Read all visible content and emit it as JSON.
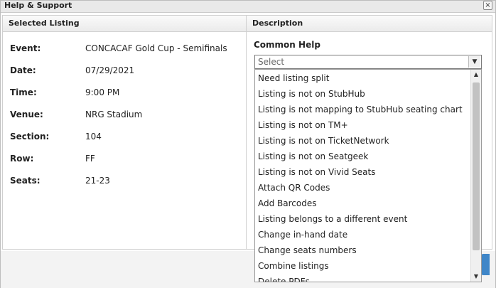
{
  "dialog": {
    "title": "Help & Support",
    "close_glyph": "×"
  },
  "left_panel": {
    "header": "Selected Listing",
    "details": [
      {
        "label": "Event:",
        "value": "CONCACAF Gold Cup - Semifinals"
      },
      {
        "label": "Date:",
        "value": "07/29/2021"
      },
      {
        "label": "Time:",
        "value": "9:00 PM"
      },
      {
        "label": "Venue:",
        "value": "NRG Stadium"
      },
      {
        "label": "Section:",
        "value": "104"
      },
      {
        "label": "Row:",
        "value": "FF"
      },
      {
        "label": "Seats:",
        "value": "21-23"
      }
    ]
  },
  "right_panel": {
    "header": "Description",
    "common_help_label": "Common Help",
    "select_value": "Select",
    "options": [
      "Need listing split",
      "Listing is not on StubHub",
      "Listing is not mapping to StubHub seating chart",
      "Listing is not on TM+",
      "Listing is not on TicketNetwork",
      "Listing is not on Seatgeek",
      "Listing is not on Vivid Seats",
      "Attach QR Codes",
      "Add Barcodes",
      "Listing belongs to a different event",
      "Change in-hand date",
      "Change seats numbers",
      "Combine listings",
      "Delete PDFs"
    ]
  },
  "icons": {
    "select_arrow": "chevron-down-icon",
    "scroll_up": "scroll-up-icon",
    "scroll_down": "scroll-down-icon"
  }
}
